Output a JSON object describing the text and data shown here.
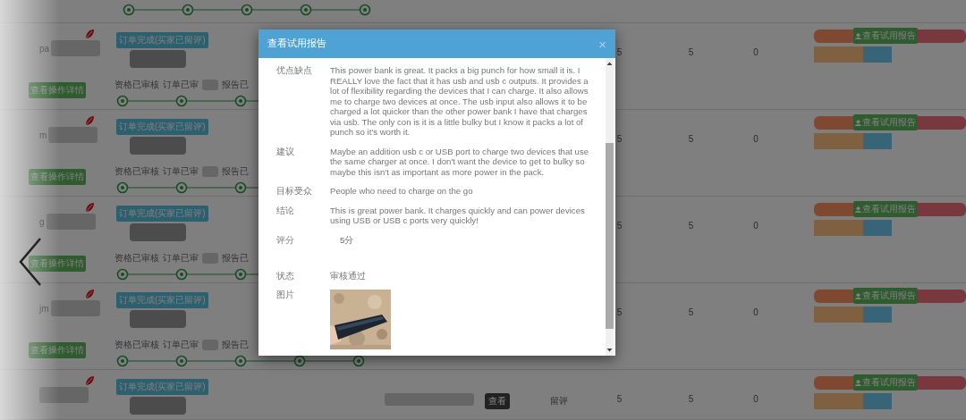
{
  "orders": [
    {
      "kind": "cut-top"
    },
    {
      "kind": "full",
      "user": "pa",
      "status": "订单完成(买家已留评)",
      "steps": [
        "资格已审核",
        "订单已审",
        "报告已"
      ],
      "detail_button": "查看操作详情",
      "counts": [
        "5",
        "5",
        "0"
      ],
      "report_button": "查看试用报告"
    },
    {
      "kind": "full",
      "user": "m",
      "status": "订单完成(买家已留评)",
      "steps": [
        "资格已审核",
        "订单已审",
        "报告已"
      ],
      "detail_button": "查看操作详情",
      "counts": [
        "5",
        "5",
        "0"
      ],
      "report_button": "查看试用报告"
    },
    {
      "kind": "full",
      "user": "g",
      "status": "订单完成(买家已留评)",
      "steps": [
        "资格已审核",
        "订单已审",
        "报告已"
      ],
      "detail_button": "查看操作详情",
      "counts": [
        "5",
        "5",
        "0"
      ],
      "report_button": "查看试用报告"
    },
    {
      "kind": "full",
      "user": "jm",
      "status": "订单完成(买家已留评)",
      "steps": [
        "资格已审核",
        "订单已审",
        "报告已"
      ],
      "detail_button": "查看操作详情",
      "counts": [
        "5",
        "5",
        "0"
      ],
      "report_button": "查看试用报告"
    },
    {
      "kind": "cut-bottom",
      "status": "订单完成(买家已留评)",
      "view_button": "查看",
      "review": "留评",
      "counts": [
        "5",
        "5",
        "0"
      ],
      "report_button": "查看试用报告"
    }
  ],
  "report_modal": {
    "title": "查看试用报告",
    "close": "×",
    "fields": [
      {
        "kind": "text",
        "label": "优点缺点",
        "value": "This power bank is great. It packs a big punch for how small it is. I REALLY love the fact that it has usb and usb c outputs. It provides a lot of flexibility regarding the devices that I can charge. It also allows me to charge two devices at once. The usb input also allows it to be charged a lot quicker than the other power bank I have that charges via usb. The only con is it is a little bulky but I know it packs a lot of punch so it's worth it."
      },
      {
        "kind": "text",
        "label": "建议",
        "value": "Maybe an addition usb c or USB port to charge two devices that use the same charger at once. I don't want the device to get to bulky so maybe this isn't as important as more power in the pack."
      },
      {
        "kind": "text",
        "label": "目标受众",
        "value": "People who need to charge on the go"
      },
      {
        "kind": "text",
        "label": "结论",
        "value": "This is great power bank. It charges quickly and can power devices using USB or USB c ports very quickly!"
      },
      {
        "kind": "score",
        "label": "评分",
        "value": "5分"
      },
      {
        "kind": "text",
        "label": "状态",
        "value": "审核通过"
      },
      {
        "kind": "picture",
        "label": "图片"
      }
    ]
  }
}
